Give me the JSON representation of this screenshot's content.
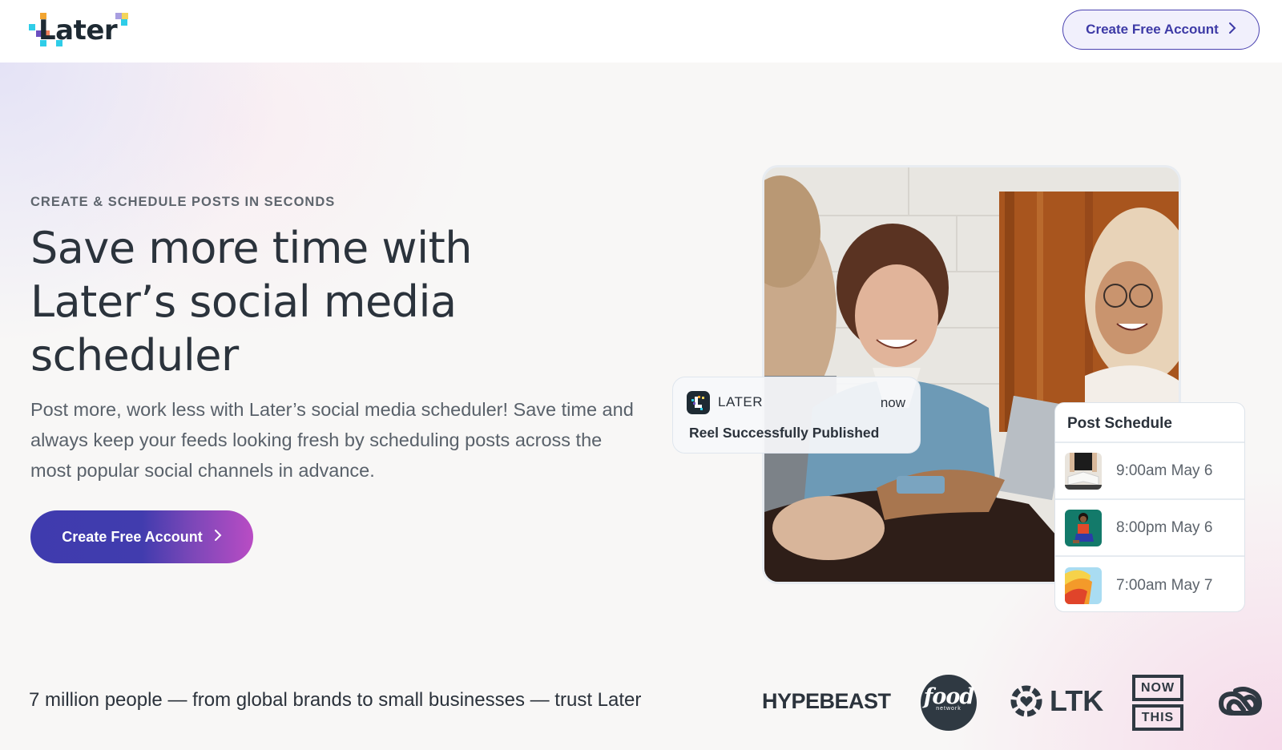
{
  "header": {
    "logo_text": "Later",
    "cta_label": "Create Free Account",
    "cta_icon": "chevron-right-icon"
  },
  "hero": {
    "eyebrow": "CREATE & SCHEDULE POSTS IN SECONDS",
    "headline_lines": [
      "Save more time with",
      "Later’s social media",
      "scheduler"
    ],
    "subtext": "Post more, work less with Later’s social media scheduler! Save time and always keep your feeds looking fresh by scheduling posts across the most popular social channels in advance.",
    "cta_label": "Create Free Account",
    "cta_icon": "chevron-right-icon"
  },
  "notification": {
    "app_name": "LATER",
    "time": "now",
    "message": "Reel Successfully Published"
  },
  "post_schedule": {
    "title": "Post Schedule",
    "items": [
      {
        "time": "9:00am May 6",
        "thumbnail": "person-reading-book"
      },
      {
        "time": "8:00pm May 6",
        "thumbnail": "person-sitting-green-background"
      },
      {
        "time": "7:00am May 7",
        "thumbnail": "colorful-abstract-shapes"
      }
    ]
  },
  "trust": {
    "text": "7 million people — from global brands to small businesses — trust Later",
    "brands": [
      {
        "name": "HYPEBEAST"
      },
      {
        "name": "food",
        "subname": "network"
      },
      {
        "name": "LTK"
      },
      {
        "name": "NOW",
        "subname": "THIS"
      },
      {
        "name": "Adobe Creative Cloud"
      }
    ]
  },
  "colors": {
    "brand_primary": "#413cae",
    "brand_gradient_end": "#b94cc4",
    "text_dark": "#2b333c",
    "text_muted": "#5e656d"
  }
}
